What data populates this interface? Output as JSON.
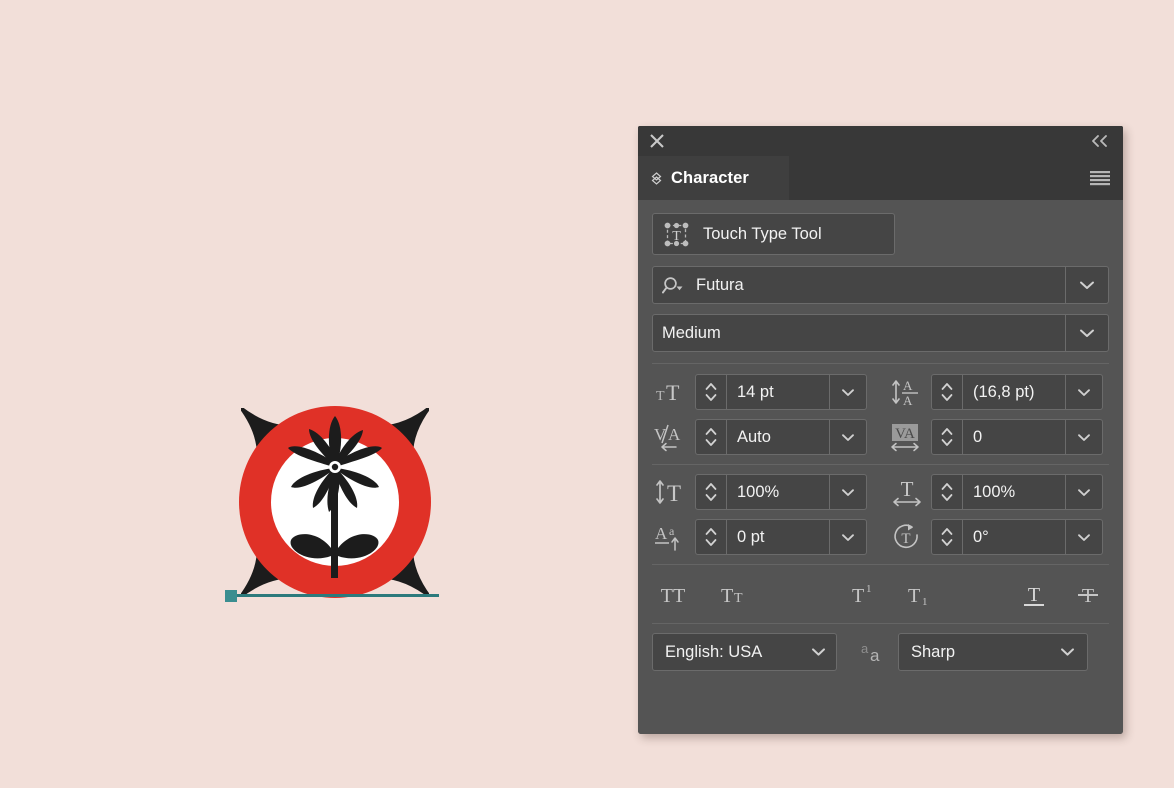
{
  "app": {
    "canvas_background": "#f2dfd9",
    "panel_background": "#545454"
  },
  "artwork": {
    "name": "flower-emblem-logo",
    "colors": {
      "black": "#1c1c1c",
      "red": "#e03127",
      "white": "#ffffff",
      "selection": "#2c7a7c",
      "anchor": "#3a8e90"
    }
  },
  "panel": {
    "titlebar": {
      "close_icon": "close-icon",
      "collapse_icon": "double-chevron-left-icon"
    },
    "tab": {
      "label": "Character",
      "diamond_icon": "diamond-handle-icon",
      "menu_icon": "hamburger-menu-icon"
    },
    "touch_type": {
      "label": "Touch Type Tool",
      "icon": "touch-type-tool-icon"
    },
    "font_family": {
      "value": "Futura",
      "icon": "search-dropdown-icon",
      "caret": "chevron-down-icon"
    },
    "font_style": {
      "value": "Medium",
      "caret": "chevron-down-icon"
    },
    "fields": [
      {
        "name": "font-size",
        "icon": "font-size-icon",
        "value": "14 pt"
      },
      {
        "name": "leading",
        "icon": "leading-icon",
        "value": "(16,8 pt)"
      },
      {
        "name": "kerning",
        "icon": "kerning-icon",
        "value": "Auto"
      },
      {
        "name": "tracking",
        "icon": "tracking-icon",
        "value": "0"
      },
      {
        "name": "vertical-scale",
        "icon": "vertical-scale-icon",
        "value": "100%"
      },
      {
        "name": "horizontal-scale",
        "icon": "horizontal-scale-icon",
        "value": "100%"
      },
      {
        "name": "baseline-shift",
        "icon": "baseline-shift-icon",
        "value": "0 pt"
      },
      {
        "name": "character-rotation",
        "icon": "character-rotation-icon",
        "value": "0°"
      }
    ],
    "style_buttons": [
      {
        "name": "all-caps",
        "icon": "all-caps-icon"
      },
      {
        "name": "small-caps",
        "icon": "small-caps-icon"
      },
      {
        "name": "superscript",
        "icon": "superscript-icon"
      },
      {
        "name": "subscript",
        "icon": "subscript-icon"
      },
      {
        "name": "underline",
        "icon": "underline-icon"
      },
      {
        "name": "strikethrough",
        "icon": "strikethrough-icon"
      }
    ],
    "language": {
      "value": "English: USA",
      "caret": "chevron-down-icon"
    },
    "anti_aliasing": {
      "icon": "anti-aliasing-icon",
      "value": "Sharp",
      "caret": "chevron-down-icon"
    }
  }
}
